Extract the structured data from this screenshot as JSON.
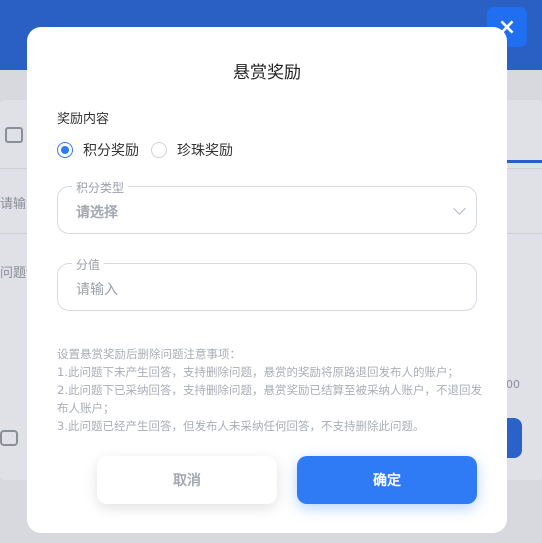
{
  "background": {
    "text_1": "请输入",
    "text_2": "问题详",
    "text_3": "00"
  },
  "close_icon": "×",
  "modal": {
    "title": "悬赏奖励",
    "section_label": "奖励内容",
    "radio_options": [
      {
        "label": "积分奖励",
        "checked": true
      },
      {
        "label": "珍珠奖励",
        "checked": false
      }
    ],
    "points_type": {
      "legend": "积分类型",
      "value": "请选择"
    },
    "score": {
      "legend": "分值",
      "placeholder": "请输入"
    },
    "notes": [
      "设置悬赏奖励后删除问题注意事项：",
      "1.此问题下未产生回答，支持删除问题，悬赏的奖励将原路退回发布人的账户；",
      "2.此问题下已采纳回答，支持删除问题，悬赏奖励已结算至被采纳人账户，不退回发布人账户；",
      "3.此问题已经产生回答，但发布人未采纳任何回答，不支持删除此问题。"
    ],
    "cancel_label": "取消",
    "ok_label": "确定"
  },
  "colors": {
    "primary": "#2f7bf5",
    "header": "#2a5fc4"
  }
}
